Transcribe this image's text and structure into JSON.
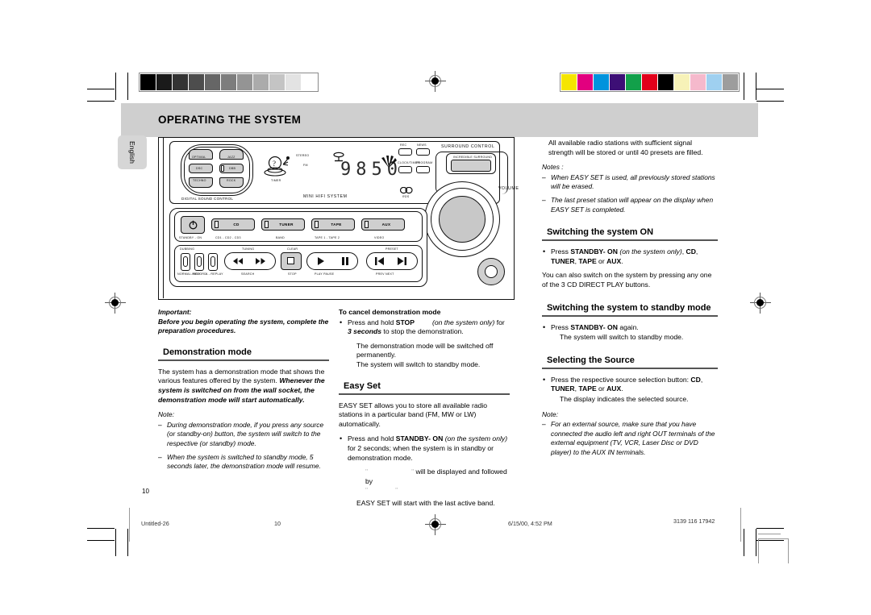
{
  "document": {
    "header_title": "OPERATING THE SYSTEM",
    "side_tab": "English",
    "page_number": "10"
  },
  "print_marks": {
    "grayscale_bar": [
      "#000000",
      "#1a1a1a",
      "#333333",
      "#4d4d4d",
      "#666666",
      "#7d7d7d",
      "#949494",
      "#ababab",
      "#c4c4c4",
      "#e3e3e3",
      "#ffffff"
    ],
    "color_bar": [
      "#f5e500",
      "#e2007f",
      "#0093dd",
      "#3d0f76",
      "#12a04a",
      "#e2001a",
      "#000000",
      "#f7f2b8",
      "#f5b9cc",
      "#9fd0f0",
      "#9d9d9d"
    ]
  },
  "illustration": {
    "caption_dsc": "DIGITAL SOUND CONTROL",
    "caption_center": "MINI HIFI SYSTEM",
    "caption_surround": "SURROUND CONTROL",
    "caption_volume": "VOLUME",
    "display_value": "9850",
    "display_stereo": "STEREO",
    "display_fm": "FM",
    "display_timer": "TIMER",
    "logo_cd": "CD",
    "logo_rds": "RDS",
    "dsc_buttons": [
      "OPTIMAL",
      "JAZZ",
      "DSC",
      "DBB",
      "TECHNO",
      "ROCK"
    ],
    "top_right_buttons": [
      "REC",
      "NEWS",
      "CLOCK/TIMER",
      "PROGRAM"
    ],
    "surround_button": "INCREDIBLE SURROUND",
    "source_buttons": [
      {
        "label": "CD",
        "sub": "CD1 - CD2 - CD3"
      },
      {
        "label": "TUNER",
        "sub": "BAND"
      },
      {
        "label": "TAPE",
        "sub": "TAPE 1 - TAPE 2"
      },
      {
        "label": "AUX",
        "sub": "VIDEO"
      }
    ],
    "standby_label": "STANDBY - ON",
    "left_small_buttons": [
      {
        "top": "DUBBING",
        "bottom": "NORMAL-HIGH"
      },
      {
        "top": "",
        "bottom": "RECORD"
      },
      {
        "top": "",
        "bottom": "A - REPLAY"
      }
    ],
    "transport_groups": [
      {
        "top": "TUNING",
        "bottom": "SEARCH"
      },
      {
        "top": "CLEAR",
        "bottom": "STOP"
      },
      {
        "top": "",
        "bottom": "PLAY        PAUSE"
      },
      {
        "top": "PRESET",
        "bottom": "PREV        NEXT"
      }
    ]
  },
  "left_column": {
    "important_label": "Important:",
    "important_text": "Before you begin operating the system, complete the preparation procedures.",
    "heading": "Demonstration mode",
    "para1_a": "The system has a demonstration mode that shows the various features offered by the system.",
    "para1_b": "Whenever the system is switched on from the wall socket, the demonstration mode will start automatically.",
    "note_label": "Note:",
    "notes": [
      "During demonstration mode, if you press any source (or standby-on) button, the system will switch to the respective (or standby) mode.",
      "When the system is switched to standby mode, 5 seconds later, the demonstration mode will resume."
    ]
  },
  "middle_column": {
    "cancel_heading": "To cancel demonstration mode",
    "cancel_bullet_pre": "Press and hold ",
    "cancel_bullet_stop": "STOP",
    "cancel_bullet_paren": "(on the system only)",
    "cancel_bullet_for": " for ",
    "cancel_bullet_sec": "3 seconds",
    "cancel_bullet_post": " to stop the demonstration.",
    "cancel_line2": "The demonstration mode will be switched off permanently.",
    "cancel_line3": "The system will switch to standby mode.",
    "easyset_heading": "Easy Set",
    "easyset_para": "EASY SET allows you to store all available radio stations in a particular band (FM, MW or LW) automatically.",
    "easyset_bullet_pre": "Press and hold ",
    "easyset_bullet_btn": "STANDBY- ON",
    "easyset_bullet_paren": "(on the system only)",
    "easyset_bullet_post": " for 2 seconds; when the system is in standby or demonstration mode.",
    "easyset_display_1": "\"",
    "easyset_display_2": "\"",
    "easyset_display_line": " will be displayed and followed by",
    "easyset_display_3": "\"",
    "easyset_display_4": "\"",
    "easyset_last": "EASY SET will start with the last active band."
  },
  "right_column": {
    "intro": "All available radio stations with sufficient signal strength will be stored or until 40 presets are filled.",
    "notes_label": "Notes :",
    "notes": [
      "When EASY SET is used, all previously stored stations will be erased.",
      "The last preset station will appear on the display when EASY SET is completed."
    ],
    "heading_on": "Switching the system ON",
    "on_bullet_pre": "Press ",
    "on_bullet_btn": "STANDBY- ON",
    "on_bullet_paren": "(on the system only)",
    "on_bullet_mid": ", ",
    "on_bullet_cd": "CD",
    "on_bullet_line2_a": "TUNER",
    "on_bullet_line2_b": "TAPE",
    "on_bullet_line2_or": " or ",
    "on_bullet_line2_c": "AUX",
    "on_para": "You can also switch on the system by pressing any one of the 3 CD DIRECT PLAY buttons.",
    "heading_standby": "Switching the system to standby mode",
    "standby_bullet_pre": "Press ",
    "standby_bullet_btn": "STANDBY- ON",
    "standby_bullet_post": " again.",
    "standby_line2": "The system will switch to standby mode.",
    "heading_source": "Selecting the Source",
    "source_bullet_pre": "Press the respective source selection button: ",
    "source_bullet_cd": "CD",
    "source_line2_a": "TUNER",
    "source_line2_b": "TAPE",
    "source_line2_or": " or ",
    "source_line2_c": "AUX",
    "source_line3": "The display indicates the selected source.",
    "note_label": "Note:",
    "note_text": "For an external source, make sure that you have connected the audio left and right OUT terminals of the external equipment (TV, VCR, Laser Disc or DVD player) to the AUX IN terminals."
  },
  "footer": {
    "file_name": "Untitled-26",
    "page": "10",
    "timestamp": "6/15/00, 4:52 PM",
    "doc_code": "3139 116 17942"
  }
}
